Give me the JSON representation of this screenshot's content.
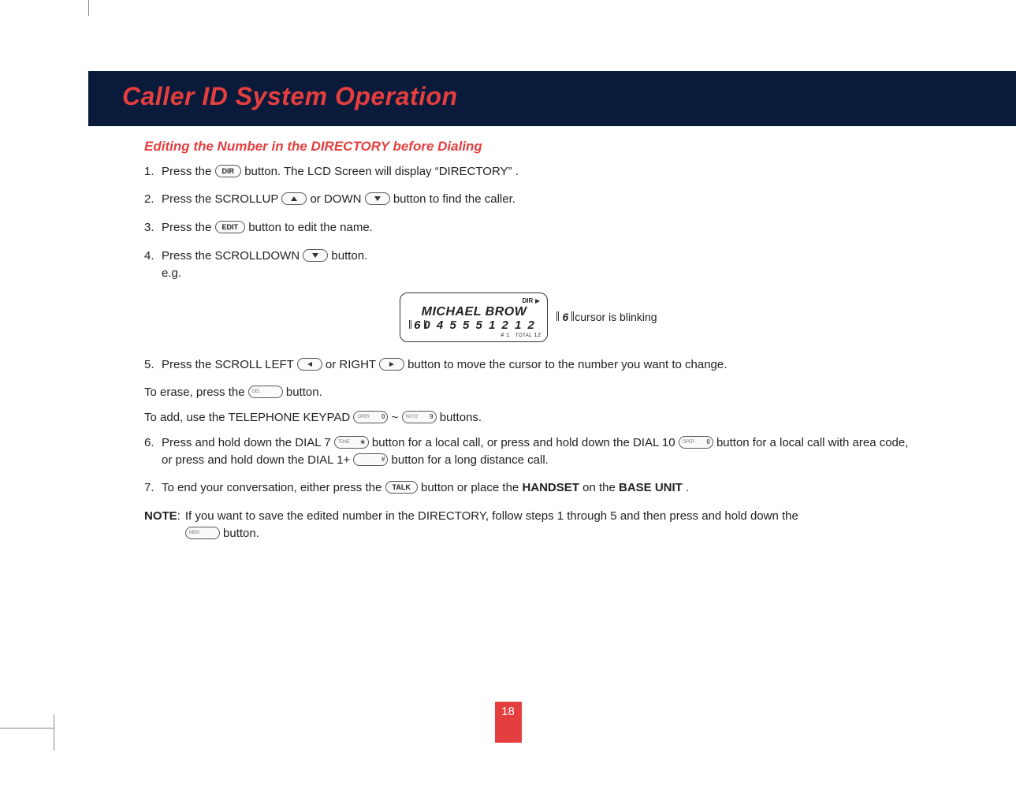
{
  "page": {
    "title": "Caller ID System Operation",
    "section_title": "Editing the Number in the DIRECTORY before Dialing",
    "number": "18"
  },
  "buttons": {
    "dir": "DIR",
    "edit": "EDIT",
    "talk": "TALK"
  },
  "steps": {
    "s1_a": "Press the ",
    "s1_b": " button. The LCD Screen will display ",
    "s1_quoted": "“DIRECTORY”",
    "s1_c": ".",
    "s2_a": "Press the SCROLLUP ",
    "s2_b": " or DOWN ",
    "s2_c": " button to find the caller.",
    "s3_a": "Press the ",
    "s3_b": " button to edit the name.",
    "s4_a": "Press the SCROLLDOWN ",
    "s4_b": " button.",
    "s4_eg": "e.g.",
    "s5_a": "Press the SCROLL LEFT ",
    "s5_b": " or RIGHT ",
    "s5_c": " button to move the cursor to the number you want to change.",
    "erase_a": "To erase, press the ",
    "erase_b": " button.",
    "add_a": "To add, use the TELEPHONE KEYPAD ",
    "add_b": " ~ ",
    "add_c": " buttons.",
    "s6_a": "Press and hold down the DIAL 7 ",
    "s6_b": " button for a local call, or press and hold down the DIAL 10 ",
    "s6_c": " button for a local call with area code, or press and hold down the DIAL 1+ ",
    "s6_d": " button for a long distance call.",
    "s7_a": "To end your conversation, either press the ",
    "s7_b": " button or place the ",
    "s7_handset": "HANDSET",
    "s7_c": " on the ",
    "s7_base": "BASE UNIT",
    "s7_d": "."
  },
  "lcd": {
    "dir_label": "DIR",
    "name": "MICHAEL BROW",
    "number_prefix": "6",
    "number_rest": "0 4 5 5 5 1 2 1 2",
    "hash_label": "#",
    "hash_value": "1",
    "total_label": "TOTAL",
    "total_value": "12",
    "cursor_note_sample": "6",
    "cursor_note_text": "cursor is blinking"
  },
  "note": {
    "label": "NOTE",
    "colon": ":",
    "text_a": "If you want to save the edited number in the DIRECTORY, follow steps 1 through 5 and then press and hold down the ",
    "text_b": " button."
  },
  "keypad": {
    "zero_hint": "OPER",
    "zero_digit": "0",
    "nine_hint": "WXYZ",
    "nine_digit": "9",
    "star_hint": "TONE",
    "star_digit": "★",
    "hash_hint": "",
    "hash_digit": "#",
    "del_hint": "DEL",
    "del_digit": "",
    "mem_hint": "MEM",
    "mem_digit": ""
  }
}
